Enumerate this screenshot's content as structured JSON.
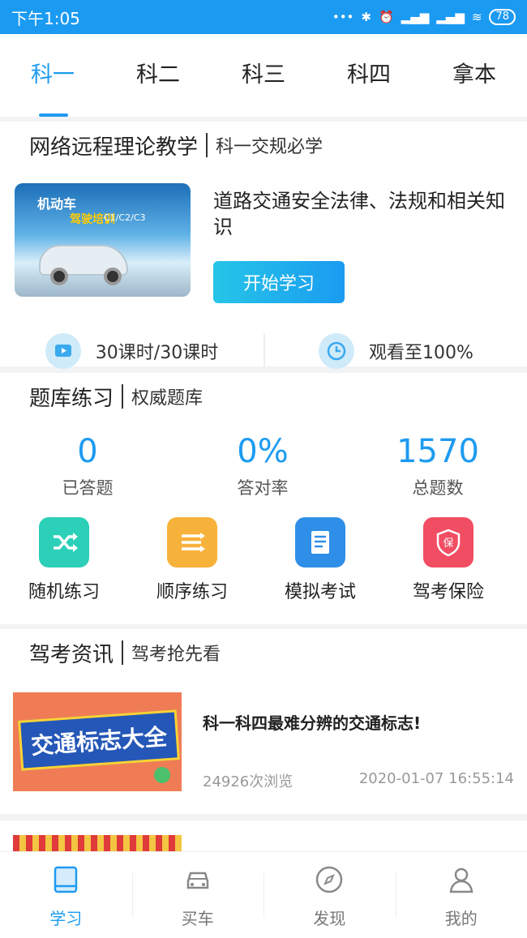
{
  "status_bar": {
    "time": "下午1:05",
    "battery": "78"
  },
  "tabs": [
    {
      "label": "科一",
      "active": true
    },
    {
      "label": "科二",
      "active": false
    },
    {
      "label": "科三",
      "active": false
    },
    {
      "label": "科四",
      "active": false
    },
    {
      "label": "拿本",
      "active": false
    }
  ],
  "theory": {
    "title": "网络远程理论教学",
    "subtitle": "科一交规必学",
    "thumb_text_1": "机动车",
    "thumb_text_2": "驾驶培训",
    "thumb_text_3": "C1/C2/C3",
    "course_title": "道路交通安全法律、法规和相关知识",
    "start_label": "开始学习",
    "lessons": "30课时/30课时",
    "watched": "观看至100%"
  },
  "bank": {
    "title": "题库练习",
    "subtitle": "权威题库",
    "stats": [
      {
        "value": "0",
        "label": "已答题"
      },
      {
        "value": "0%",
        "label": "答对率"
      },
      {
        "value": "1570",
        "label": "总题数"
      }
    ],
    "tools": [
      {
        "label": "随机练习",
        "icon": "shuffle-icon",
        "color": "#2ccfb7"
      },
      {
        "label": "顺序练习",
        "icon": "list-order-icon",
        "color": "#f7b23b"
      },
      {
        "label": "模拟考试",
        "icon": "document-icon",
        "color": "#2f8fe8"
      },
      {
        "label": "驾考保险",
        "icon": "shield-icon",
        "color": "#f14d63"
      }
    ]
  },
  "news": {
    "title": "驾考资讯",
    "subtitle": "驾考抢先看",
    "items": [
      {
        "thumb_text": "交通标志大全",
        "title": "科一科四最难分辨的交通标志!",
        "views": "24926次浏览",
        "date": "2020-01-07 16:55:14"
      }
    ]
  },
  "bottom_nav": [
    {
      "label": "学习",
      "icon": "book-icon",
      "active": true
    },
    {
      "label": "买车",
      "icon": "car-icon",
      "active": false
    },
    {
      "label": "发现",
      "icon": "compass-icon",
      "active": false
    },
    {
      "label": "我的",
      "icon": "user-icon",
      "active": false
    }
  ],
  "colors": {
    "accent": "#1e9bf0",
    "status_bar": "#1b9af2"
  }
}
